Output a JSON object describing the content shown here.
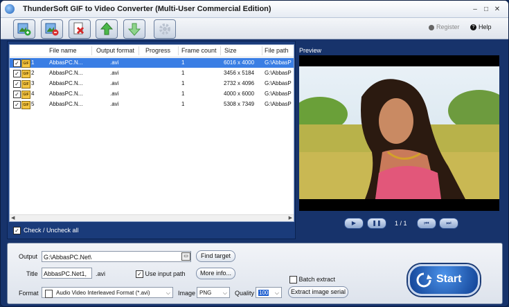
{
  "window": {
    "title": "ThunderSoft GIF to Video Converter (Multi-User Commercial Edition)",
    "minimize": "–",
    "maximize": "□",
    "close": "✕"
  },
  "toolbar": {
    "buttons": [
      {
        "name": "add-file-button",
        "icon": "add-image-icon"
      },
      {
        "name": "remove-file-button",
        "icon": "remove-image-icon"
      },
      {
        "name": "clear-list-button",
        "icon": "delete-icon"
      },
      {
        "name": "move-up-button",
        "icon": "arrow-up-icon"
      },
      {
        "name": "move-down-button",
        "icon": "arrow-down-icon"
      },
      {
        "name": "settings-button",
        "icon": "gear-icon"
      }
    ],
    "register": "Register",
    "help": "Help"
  },
  "list": {
    "columns": [
      "File name",
      "Output format",
      "Progress",
      "Frame count",
      "Size",
      "File path"
    ],
    "rows": [
      {
        "index": "1",
        "file": "AbbasPC.N...",
        "format": ".avi",
        "progress": "",
        "frames": "1",
        "size": "6016 x 4000",
        "path": "G:\\AbbasP",
        "selected": true
      },
      {
        "index": "2",
        "file": "AbbasPC.N...",
        "format": ".avi",
        "progress": "",
        "frames": "1",
        "size": "3456 x 5184",
        "path": "G:\\AbbasP",
        "selected": false
      },
      {
        "index": "3",
        "file": "AbbasPC.N...",
        "format": ".avi",
        "progress": "",
        "frames": "1",
        "size": "2732 x 4096",
        "path": "G:\\AbbasP",
        "selected": false
      },
      {
        "index": "4",
        "file": "AbbasPC.N...",
        "format": ".avi",
        "progress": "",
        "frames": "1",
        "size": "4000 x 6000",
        "path": "G:\\AbbasP",
        "selected": false
      },
      {
        "index": "5",
        "file": "AbbasPC.N...",
        "format": ".avi",
        "progress": "",
        "frames": "1",
        "size": "5308 x 7349",
        "path": "G:\\AbbasP",
        "selected": false
      }
    ],
    "check_all": "Check / Uncheck all"
  },
  "preview": {
    "label": "Preview",
    "page": "1 / 1"
  },
  "output": {
    "output_label": "Output",
    "output_value": "G:\\AbbasPC.Net\\",
    "find_target": "Find target",
    "title_label": "Title",
    "title_value": "AbbasPC.Net1,",
    "title_ext": ".avi",
    "use_input_path": "Use input path",
    "more_info": "More info...",
    "batch_extract": "Batch extract",
    "format_label": "Format",
    "format_value": "Audio Video Interleaved Format (*.avi)",
    "image_label": "Image",
    "image_value": "PNG",
    "quality_label": "Quality",
    "quality_value": "100",
    "extract_image_serial": "Extract image serial",
    "start": "Start"
  },
  "colors": {
    "frame": "#17336b",
    "selection": "#3a7ee4",
    "panel": "#1a3b7a"
  }
}
